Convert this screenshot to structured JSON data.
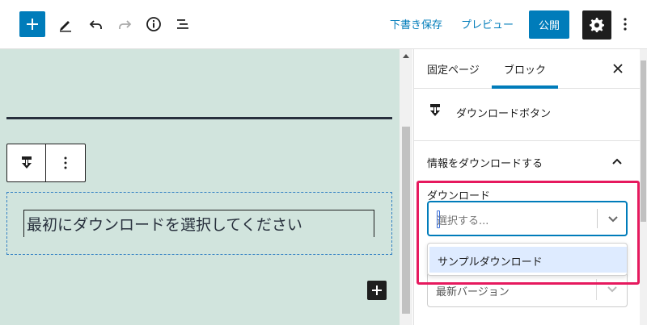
{
  "topbar": {
    "inserter_icon": "plus-icon",
    "tools": [
      "pencil-icon",
      "undo-icon",
      "redo-icon",
      "info-icon",
      "list-view-icon"
    ],
    "save_draft_label": "下書き保存",
    "preview_label": "プレビュー",
    "publish_label": "公開",
    "settings_icon": "gear-icon",
    "more_icon": "more-vertical-icon",
    "accent": "#007cba"
  },
  "canvas": {
    "background": "#d1e4dd",
    "placeholder_text": "最初にダウンロードを選択してください",
    "block_icon": "download-icon"
  },
  "sidebar": {
    "tabs": [
      {
        "label": "固定ページ",
        "active": false
      },
      {
        "label": "ブロック",
        "active": true
      }
    ],
    "block_name": "ダウンロードボタン",
    "panel_title": "情報をダウンロードする",
    "field_label": "ダウンロード",
    "select_placeholder": "選択する...",
    "dropdown_options": [
      "サンプルダウンロード"
    ],
    "second_select_value": "最新バージョン"
  },
  "highlight_color": "#e6195e"
}
